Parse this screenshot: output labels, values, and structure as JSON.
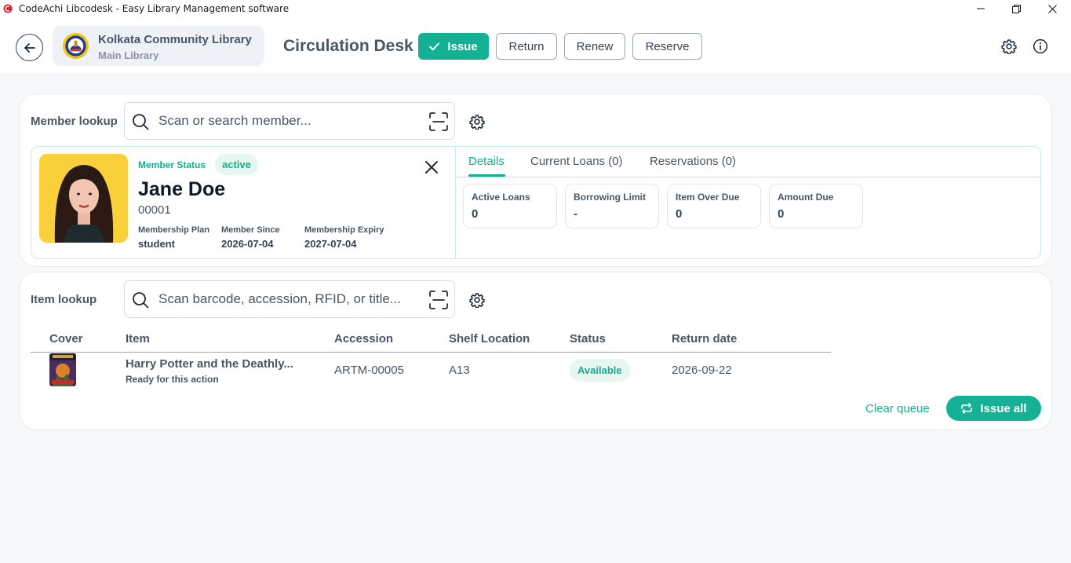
{
  "window": {
    "title": "CodeAchi Libcodesk - Easy Library Management software",
    "controls": [
      "minimize-icon",
      "restore-icon",
      "close-icon"
    ]
  },
  "header": {
    "library_name": "Kolkata Community Library",
    "library_branch": "Main Library",
    "page_title": "Circulation Desk",
    "modes": [
      {
        "label": "Issue",
        "active": true
      },
      {
        "label": "Return",
        "active": false
      },
      {
        "label": "Renew",
        "active": false
      },
      {
        "label": "Reserve",
        "active": false
      }
    ],
    "icons": [
      "back-arrow-icon",
      "settings-icon",
      "info-icon"
    ]
  },
  "member_lookup": {
    "label": "Member lookup",
    "search_placeholder": "Scan or search member...",
    "member": {
      "status_label": "Member Status",
      "status": "active",
      "name": "Jane Doe",
      "id": "00001",
      "plan_label": "Membership Plan",
      "plan": "student",
      "since_label": "Member Since",
      "since": "2026-07-04",
      "expiry_label": "Membership Expiry",
      "expiry": "2027-07-04"
    },
    "tabs": [
      {
        "label": "Details",
        "active": true
      },
      {
        "label": "Current Loans (0)",
        "active": false
      },
      {
        "label": "Reservations (0)",
        "active": false
      }
    ],
    "stats": [
      {
        "label": "Active Loans",
        "value": "0"
      },
      {
        "label": "Borrowing Limit",
        "value": "-"
      },
      {
        "label": "Item Over Due",
        "value": "0"
      },
      {
        "label": "Amount Due",
        "value": "0"
      }
    ]
  },
  "item_lookup": {
    "label": "Item lookup",
    "search_placeholder": "Scan barcode, accession, RFID, or title...",
    "columns": [
      "Cover",
      "Item",
      "Accession",
      "Shelf Location",
      "Status",
      "Return date"
    ],
    "rows": [
      {
        "title": "Harry Potter and the Deathly...",
        "note": "Ready for this action",
        "accession": "ARTM-00005",
        "shelf": "A13",
        "status": "Available",
        "return_date": "2026-09-22"
      }
    ],
    "clear_queue_label": "Clear queue",
    "issue_all_label": "Issue all"
  },
  "colors": {
    "accent": "#15b194",
    "badge_bg": "#e6f6f1",
    "avatar_bg": "#f9cf3a"
  }
}
